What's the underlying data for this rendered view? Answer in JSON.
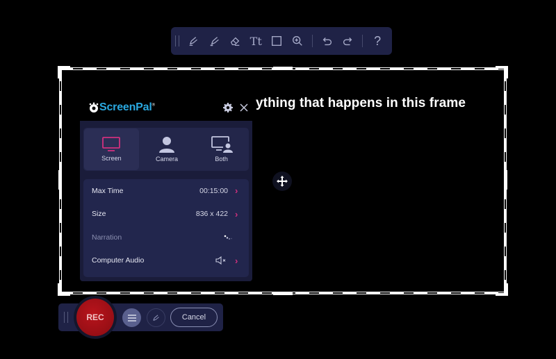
{
  "toolbar": {
    "tools": [
      {
        "name": "pen",
        "icon": "pen-icon"
      },
      {
        "name": "highlighter",
        "icon": "highlighter-icon"
      },
      {
        "name": "eraser",
        "icon": "eraser-icon"
      },
      {
        "name": "text",
        "icon": "text-icon",
        "label": "Tt"
      },
      {
        "name": "rectangle",
        "icon": "rectangle-icon"
      },
      {
        "name": "zoom",
        "icon": "zoom-in-icon"
      },
      {
        "name": "undo",
        "icon": "undo-icon"
      },
      {
        "name": "redo",
        "icon": "redo-icon"
      },
      {
        "name": "help",
        "icon": "help-icon",
        "label": "?"
      }
    ]
  },
  "frame": {
    "overlay_text": "ything that happens in this frame"
  },
  "header": {
    "logo_text": "ScreenPal",
    "trademark": "®",
    "brand_color": "#2aa8e0"
  },
  "modes": [
    {
      "label": "Screen",
      "icon": "monitor-icon",
      "active": true
    },
    {
      "label": "Camera",
      "icon": "person-icon",
      "active": false
    },
    {
      "label": "Both",
      "icon": "monitor-person-icon",
      "active": false
    }
  ],
  "settings": [
    {
      "label": "Max Time",
      "value": "00:15:00",
      "enabled": true
    },
    {
      "label": "Size",
      "value": "836 x 422",
      "enabled": true
    },
    {
      "label": "Narration",
      "value": "",
      "enabled": false
    },
    {
      "label": "Computer Audio",
      "value": "muted",
      "enabled": true
    }
  ],
  "controls": {
    "rec_label": "REC",
    "cancel_label": "Cancel"
  },
  "colors": {
    "accent": "#d0307e",
    "rec": "#a8121a",
    "panel": "#1a1c3a"
  }
}
